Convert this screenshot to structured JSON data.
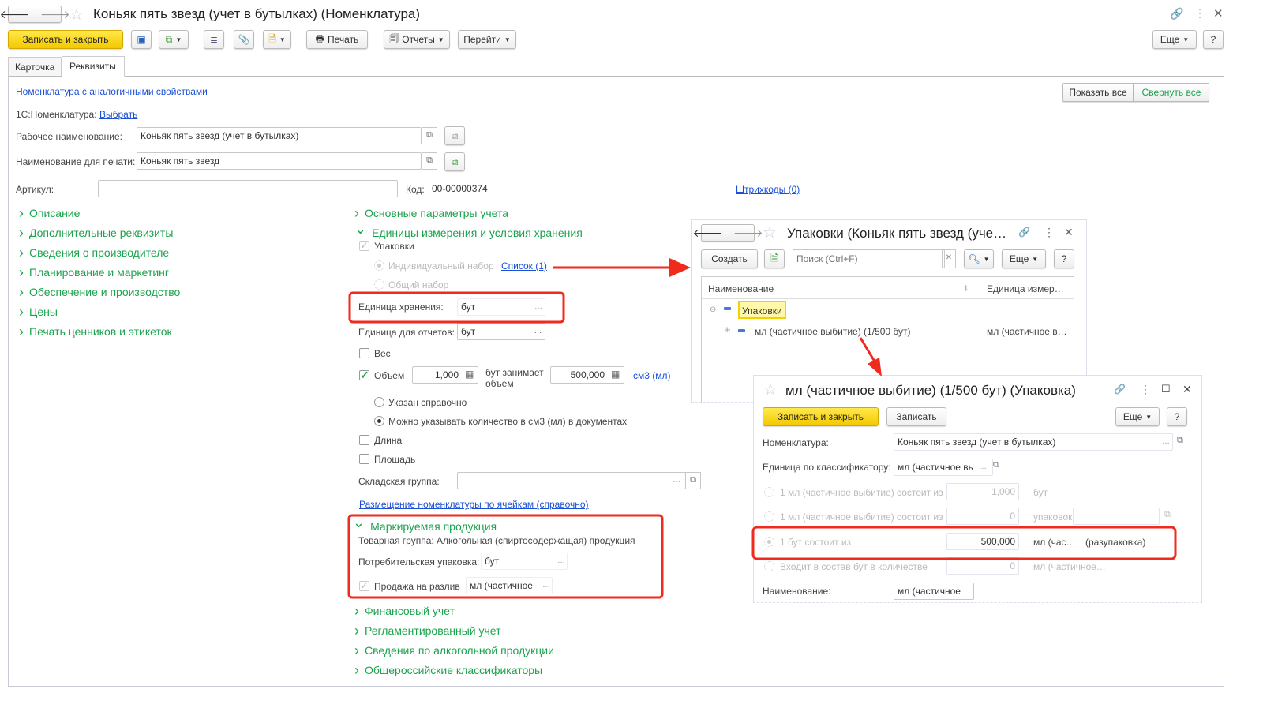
{
  "main": {
    "title": "Коньяк пять звезд (учет в бутылках) (Номенклатура)",
    "toolbar": {
      "save_close": "Записать и закрыть",
      "print": "Печать",
      "reports": "Отчеты",
      "goto": "Перейти",
      "more": "Еще",
      "help": "?"
    },
    "tabs": [
      "Карточка",
      "Реквизиты"
    ],
    "similar_link": "Номенклатура с аналогичными свойствами",
    "show_all": "Показать все",
    "collapse_all": "Свернуть все",
    "c1_label": "1С:Номенклатура:",
    "c1_link": "Выбрать",
    "work_name_label": "Рабочее наименование:",
    "work_name": "Коньяк пять звезд (учет в бутылках)",
    "print_name_label": "Наименование для печати:",
    "print_name": "Коньяк пять звезд",
    "article_label": "Артикул:",
    "article": "",
    "code_label": "Код:",
    "code": "00-00000374",
    "barcodes_link": "Штрихкоды (0)",
    "left_groups": [
      "Описание",
      "Дополнительные реквизиты",
      "Сведения о производителе",
      "Планирование и маркетинг",
      "Обеспечение и производство",
      "Цены",
      "Печать ценников и этикеток"
    ],
    "mid_groups_top": [
      "Основные параметры учета",
      "Единицы измерения и условия хранения"
    ],
    "packages_cb": "Упаковки",
    "individual_set": "Индивидуальный набор",
    "list_link": "Список (1)",
    "common_set": "Общий набор",
    "storage_unit_label": "Единица хранения:",
    "storage_unit": "бут",
    "report_unit_label": "Единица для отчетов:",
    "report_unit": "бут",
    "weight": "Вес",
    "volume": "Объем",
    "volume_value": "1,000",
    "occupies": "бут занимает объем",
    "occupies_value": "500,000",
    "volume_unit_link": "см3 (мл)",
    "ref_only": "Указан справочно",
    "can_specify": "Можно указывать количество в см3 (мл) в документах",
    "length": "Длина",
    "area": "Площадь",
    "warehouse_group_label": "Складская группа:",
    "warehouse_group": "",
    "cells_link": "Размещение номенклатуры по ячейкам (справочно)",
    "marked_group": "Маркируемая продукция",
    "product_group": "Товарная группа: Алкогольная (спиртосодержащая) продукция",
    "consumer_pack_label": "Потребительская упаковка:",
    "consumer_pack": "бут",
    "draft_sale": "Продажа на разлив",
    "draft_sale_value": "мл (частичное в",
    "mid_groups_bottom": [
      "Финансовый учет",
      "Регламентированный учет",
      "Сведения по алкогольной продукции",
      "Общероссийские классификаторы"
    ]
  },
  "packages_window": {
    "title": "Упаковки (Коньяк пять звезд (уче…",
    "create": "Создать",
    "search_placeholder": "Поиск (Ctrl+F)",
    "more": "Еще",
    "help": "?",
    "col_name": "Наименование",
    "col_unit": "Единица измер…",
    "group_row": "Упаковки",
    "rows": [
      {
        "name": "мл (частичное выбитие) (1/500 бут)",
        "unit": "мл (частичное в…"
      }
    ]
  },
  "package_form": {
    "title": "мл (частичное выбитие) (1/500 бут) (Упаковка)",
    "save_close": "Записать и закрыть",
    "save": "Записать",
    "more": "Еще",
    "help": "?",
    "nom_label": "Номенклатура:",
    "nom": "Коньяк пять звезд (учет в бутылках)",
    "class_unit_label": "Единица по классификатору:",
    "class_unit": "мл (частичное вь",
    "r1_label": "1 мл (частичное выбитие) состоит из",
    "r1_value": "1,000",
    "r1_unit": "бут",
    "r2_label": "1 мл (частичное выбитие) состоит из",
    "r2_value": "0",
    "r2_unit": "упаковок",
    "r3_label": "1 бут состоит из",
    "r3_value": "500,000",
    "r3_unit": "мл (час…",
    "r3_note": "(разупаковка)",
    "r4_label": "Входит в состав бут в количестве",
    "r4_value": "0",
    "r4_unit": "мл (частичное…",
    "name_label": "Наименование:",
    "name": "мл (частичное вь"
  },
  "colors": {
    "accent_green": "#1ba34d",
    "highlight_red": "#f02a1d",
    "button_yellow": "#f7d31c",
    "link_blue": "#1a4fd6"
  }
}
